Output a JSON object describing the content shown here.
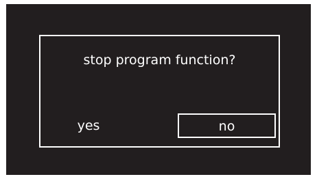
{
  "dialog": {
    "prompt": "stop program function?",
    "options": [
      {
        "label": "yes",
        "selected": false
      },
      {
        "label": "no",
        "selected": true
      }
    ]
  },
  "colors": {
    "screen_background": "#221e1f",
    "foreground": "#ffffff",
    "page_background": "#ffffff"
  }
}
